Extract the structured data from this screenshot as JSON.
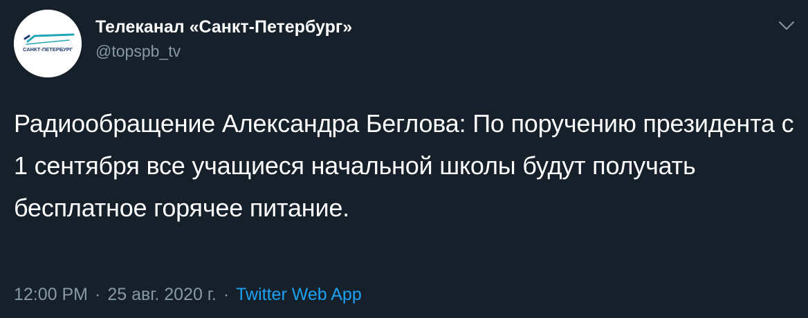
{
  "account": {
    "display_name": "Телеканал «Санкт-Петербург»",
    "handle": "@topspb_tv",
    "avatar_logo_text": "САНКТ-ПЕТЕРБУРГ"
  },
  "tweet": {
    "text": "Радиообращение Александра Беглова: По поручению президента с 1 сентября все учащиеся начальной школы будут получать бесплатное горячее питание.",
    "time": "12:00 PM",
    "date": "25 авг. 2020 г.",
    "separator": "·",
    "source": "Twitter Web App"
  },
  "icons": {
    "menu": "chevron-down-icon"
  },
  "colors": {
    "background": "#15202b",
    "primary_text": "#ffffff",
    "secondary_text": "#8899a6",
    "link": "#1da1f2",
    "logo_accent": "#20a6b4",
    "logo_text": "#1b3b73"
  }
}
